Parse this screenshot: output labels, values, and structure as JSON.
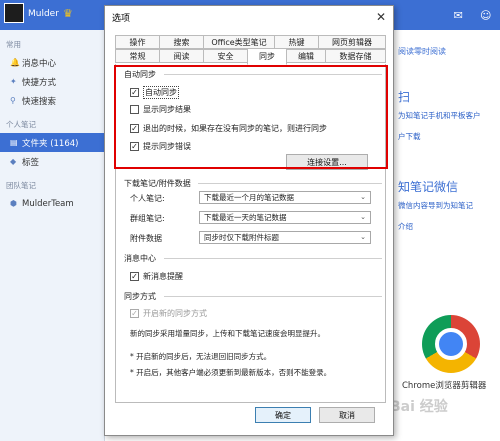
{
  "app": {
    "username": "Mulder",
    "sidebar": {
      "sections": [
        {
          "title": "常用",
          "items": [
            "消息中心",
            "快捷方式",
            "快速搜索"
          ]
        },
        {
          "title": "个人笔记",
          "items": [
            "文件夹 (1164)",
            "标签"
          ]
        },
        {
          "title": "团队笔记",
          "items": [
            "MulderTeam"
          ]
        }
      ]
    },
    "right_panel": {
      "link": "阅读零时阅读",
      "scan_title": "扫",
      "scan_desc": "为知笔记手机和平板客户",
      "download": "户下载",
      "wechat_title": "知笔记微信",
      "wechat_desc": "微信内容导到为知笔记",
      "wechat_more": "介绍",
      "chrome_label": "Chrome浏览器剪辑器"
    },
    "watermark": "Bai 经验"
  },
  "dialog": {
    "title": "选项",
    "close": "✕",
    "tabs_row1": [
      "操作",
      "搜索",
      "Office类型笔记",
      "热键",
      "网页剪辑器"
    ],
    "tabs_row2": [
      "常规",
      "阅读",
      "安全",
      "同步",
      "编辑",
      "数据存储"
    ],
    "sync_group": {
      "title": "自动同步",
      "options": [
        "自动同步",
        "显示同步结果",
        "退出的时候，如果存在没有同步的笔记，则进行同步",
        "提示同步错误"
      ],
      "checked": [
        true,
        false,
        true,
        true
      ],
      "conn_button": "连接设置..."
    },
    "download_group": {
      "title": "下载笔记/附件数据",
      "rows": [
        {
          "label": "个人笔记:",
          "value": "下载最近一个月的笔记数据"
        },
        {
          "label": "群组笔记:",
          "value": "下载最近一天的笔记数据"
        },
        {
          "label": "附件数据",
          "value": "同步时仅下载附件标题"
        }
      ]
    },
    "message_group": {
      "title": "消息中心",
      "option": "新消息提醒",
      "checked": true
    },
    "sync_mode_group": {
      "title": "同步方式",
      "option": "开启新的同步方式",
      "desc": "新的同步采用增量同步，上传和下载笔记速度会明显提升。",
      "note1": "* 开启新的同步后，无法退回旧同步方式。",
      "note2": "* 开启后，其他客户端必须更新到最新版本，否则不能登录。"
    },
    "ok": "确定",
    "cancel": "取消"
  }
}
